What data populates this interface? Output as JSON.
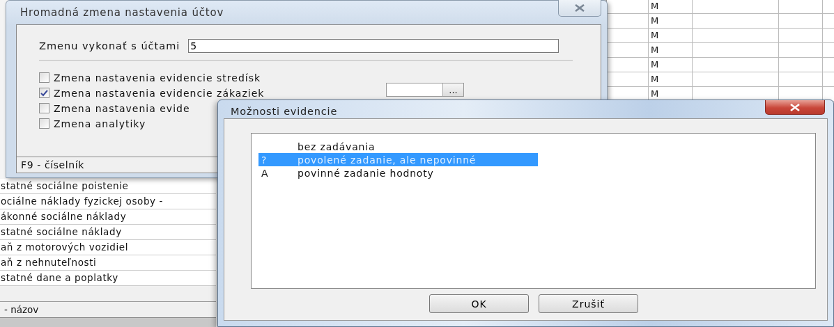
{
  "background_app": {
    "grid_rows": [
      {
        "column_2": "M"
      },
      {
        "column_2": "M"
      },
      {
        "column_2": "M"
      },
      {
        "column_2": "M"
      },
      {
        "column_2": "M"
      },
      {
        "column_2": "M"
      },
      {
        "column_2": "M"
      }
    ],
    "list_rows": [
      "statné sociálne poistenie",
      "ociálne náklady fyzickej osoby -",
      "ákonné sociálne náklady",
      "statné sociálne náklady",
      "aň z motorových vozidiel",
      "aň z nehnuteľnosti",
      "statné dane a poplatky"
    ],
    "status": "- názov"
  },
  "mass_change_dialog": {
    "title": "Hromadná zmena nastavenia účtov",
    "accounts_label": "Zmenu vykonať s účtami",
    "accounts_value": "5",
    "options": [
      {
        "label": "Zmena nastavenia evidencie stredísk",
        "checked": false
      },
      {
        "label": "Zmena nastavenia evidencie zákaziek",
        "checked": true
      },
      {
        "label": "Zmena nastavenia evide",
        "checked": false
      },
      {
        "label": "Zmena analytiky",
        "checked": false
      }
    ],
    "picker_button": "...",
    "status": "F9 - číselník"
  },
  "options_dialog": {
    "title": "Možnosti evidencie",
    "items": [
      {
        "label": "bez zadávania",
        "selected": false
      },
      {
        "code": "?",
        "label": "povolené zadanie, ale nepovinné",
        "selected": true
      },
      {
        "code": "A",
        "label": "povinné zadanie hodnoty",
        "selected": false
      }
    ],
    "buttons": [
      "OK",
      "Zrušiť"
    ]
  }
}
